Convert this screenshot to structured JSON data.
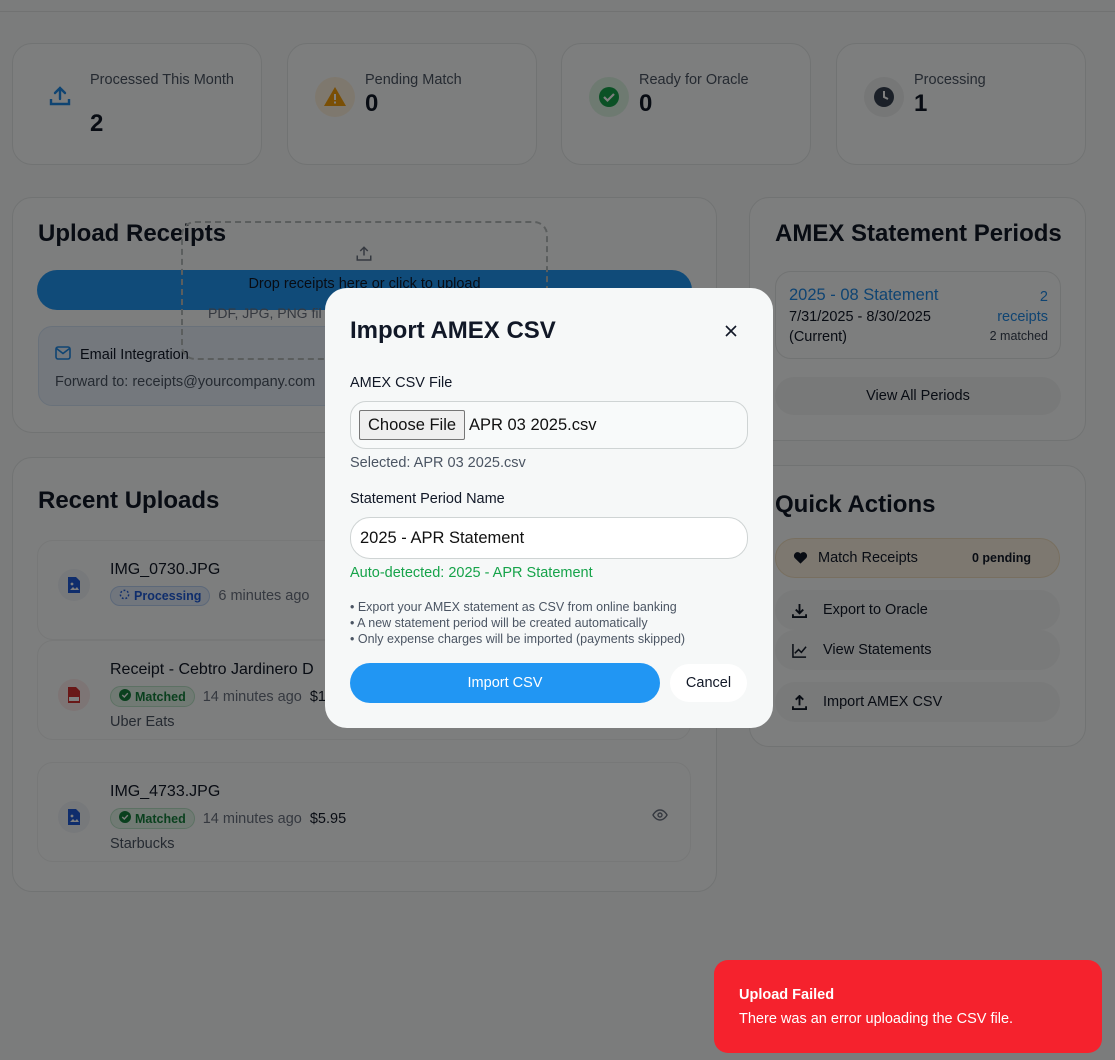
{
  "stats": [
    {
      "label": "Processed This Month",
      "value": "2",
      "icon": "upload-icon",
      "color": "#1e88e5"
    },
    {
      "label": "Pending Match",
      "value": "0",
      "icon": "warning-icon",
      "color": "#f59e0b"
    },
    {
      "label": "Ready for Oracle",
      "value": "0",
      "icon": "check-circle-icon",
      "color": "#16a34a"
    },
    {
      "label": "Processing",
      "value": "1",
      "icon": "clock-icon",
      "color": "#374151"
    }
  ],
  "upload": {
    "title": "Upload Receipts",
    "drop_text": "Drop receipts here or click to upload",
    "drop_sub": "PDF, JPG, PNG fil",
    "email_title": "Email Integration",
    "email_text": "Forward to: receipts@yourcompany.com"
  },
  "recent": {
    "title": "Recent Uploads",
    "items": [
      {
        "name": "IMG_0730.JPG",
        "status": "Processing",
        "time": "6 minutes ago",
        "amount": "",
        "merchant": ""
      },
      {
        "name": "Receipt - Cebtro Jardinero D",
        "status": "Matched",
        "time": "14 minutes ago",
        "amount": "$1",
        "merchant": "Uber Eats"
      },
      {
        "name": "IMG_4733.JPG",
        "status": "Matched",
        "time": "14 minutes ago",
        "amount": "$5.95",
        "merchant": "Starbucks"
      }
    ]
  },
  "periods": {
    "title": "AMEX Statement Periods",
    "item": {
      "name": "2025 - 08 Statement",
      "range": "7/31/2025 - 8/30/2025",
      "current": "(Current)",
      "receipts_count": "2",
      "receipts_label": "receipts",
      "matched": "2 matched"
    },
    "view_all": "View All Periods"
  },
  "quick": {
    "title": "Quick Actions",
    "match_label": "Match Receipts",
    "match_badge": "0 pending",
    "export_label": "Export to Oracle",
    "view_label": "View Statements",
    "import_label": "Import AMEX CSV"
  },
  "modal": {
    "title": "Import AMEX CSV",
    "file_label": "AMEX CSV File",
    "choose_btn": "Choose File",
    "file_name": "APR 03 2025.csv",
    "selected": "Selected: APR 03 2025.csv",
    "period_label": "Statement Period Name",
    "period_value": "2025 - APR Statement",
    "auto_detected": "Auto-detected: 2025 - APR Statement",
    "notes": [
      "• Export your AMEX statement as CSV from online banking",
      "• A new statement period will be created automatically",
      "• Only expense charges will be imported (payments skipped)"
    ],
    "import_btn": "Import CSV",
    "cancel_btn": "Cancel"
  },
  "toast": {
    "title": "Upload Failed",
    "message": "There was an error uploading the CSV file."
  }
}
